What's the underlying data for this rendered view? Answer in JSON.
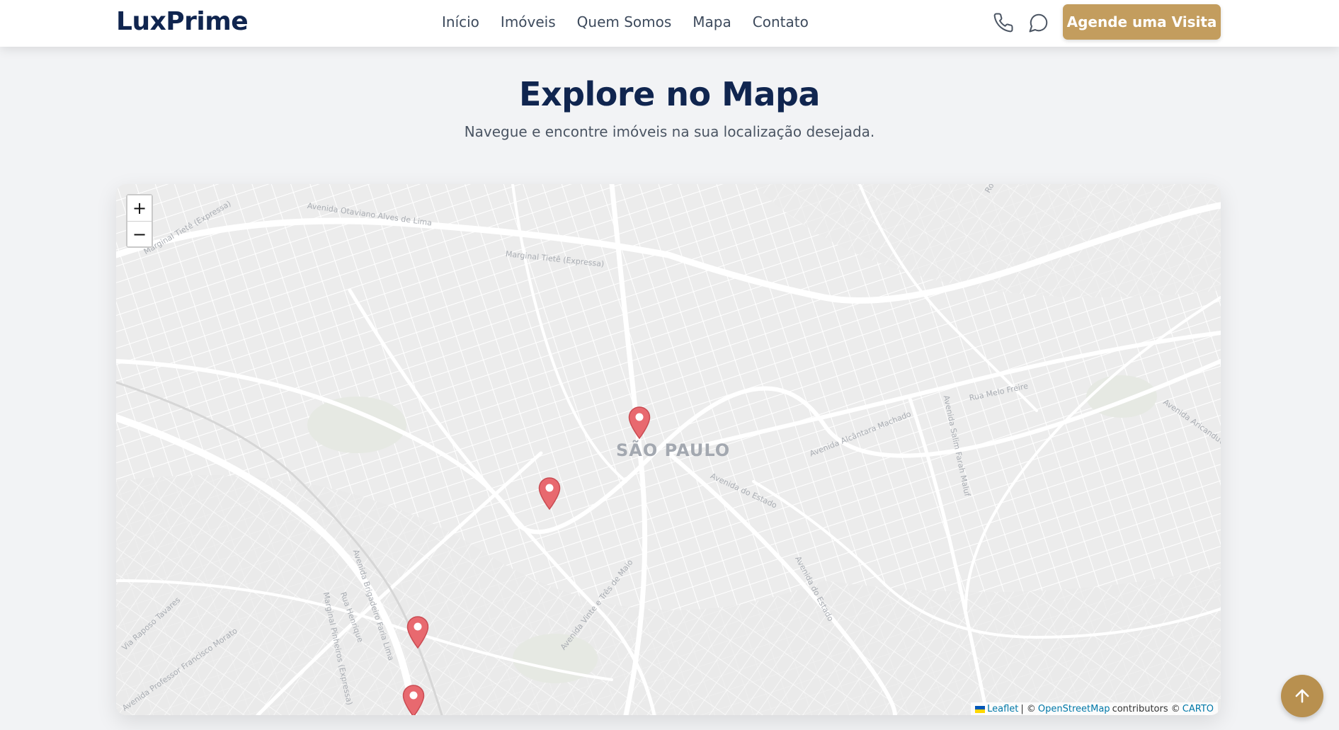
{
  "header": {
    "logo": "LuxPrime",
    "nav": [
      "Início",
      "Imóveis",
      "Quem Somos",
      "Mapa",
      "Contato"
    ],
    "phone_icon": "phone-icon",
    "chat_icon": "chat-bubble-icon",
    "cta_label": "Agende uma Visita"
  },
  "section": {
    "title": "Explore no Mapa",
    "subtitle": "Navegue e encontre imóveis na sua localização desejada."
  },
  "map": {
    "city_label": "SÃO PAULO",
    "zoom_in": "+",
    "zoom_out": "−",
    "streets": [
      "Avenida Otaviano Alves de Lima",
      "Marginal Tietê (Expressa)",
      "Marginal Tietê (Expressa)",
      "Rua Melo Freire",
      "Avenida Alcântara Machado",
      "Avenida do Estado",
      "Avenida do Estado",
      "Avenida Brigadeiro Faria Lima",
      "Avenida Vinte e Três de Maio",
      "Avenida Professor Francisco Morato",
      "Via Raposo Tavares",
      "Marginal Pinheiros (Expressa)",
      "Rua Henrique",
      "Avenida Salim Farah Maluf",
      "Rodovia",
      "Avenida Aricanduva"
    ],
    "marker_count": 4,
    "attribution": {
      "leaflet": "Leaflet",
      "sep": "| ©",
      "osm": "OpenStreetMap",
      "contributors": "contributors ©",
      "carto": "CARTO"
    }
  },
  "colors": {
    "brand_navy": "#10254f",
    "accent_gold": "#c39d5e",
    "marker": "#e8696f"
  },
  "scroll_top_icon": "arrow-up-icon"
}
